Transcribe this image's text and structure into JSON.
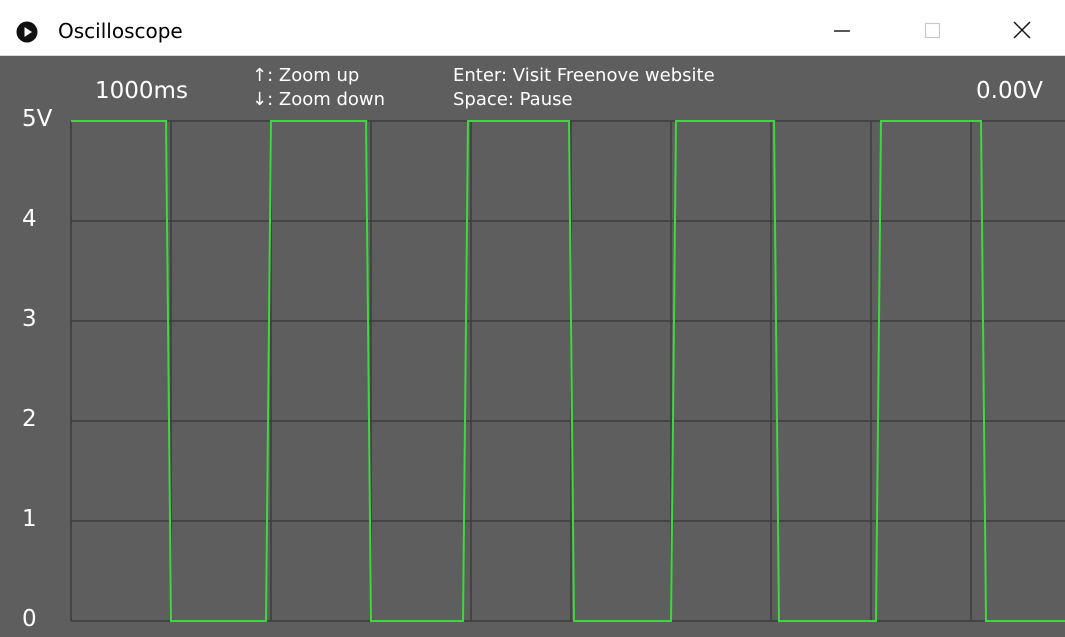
{
  "window": {
    "title": "Oscilloscope"
  },
  "colors": {
    "background": "#5e5e5e",
    "grid": "#3c3c3c",
    "trace": "#3cd83c",
    "text": "#ffffff"
  },
  "hud": {
    "timebase": "1000ms",
    "voltage": "0.00V",
    "hints": {
      "zoom_up": "↑: Zoom up",
      "zoom_down": "↓: Zoom down",
      "enter": "Enter: Visit Freenove website",
      "space": "Space: Pause"
    }
  },
  "axis": {
    "y_labels": [
      "5V",
      "4",
      "3",
      "2",
      "1",
      "0"
    ],
    "y_max": 5,
    "y_min": 0
  },
  "signal": {
    "type": "square",
    "high_v": 5,
    "low_v": 0,
    "initial_level": "high",
    "transition_times_div": [
      0.95,
      1.95,
      2.95,
      3.92,
      4.98,
      6.0,
      7.03,
      8.05,
      9.1
    ],
    "visible_span_div": 9.95
  }
}
